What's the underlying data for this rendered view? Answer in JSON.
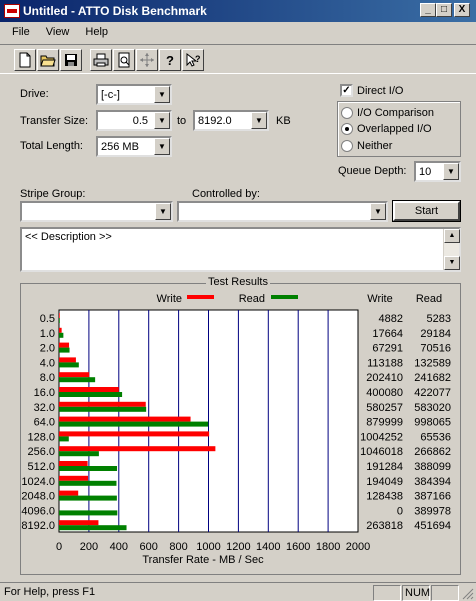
{
  "window": {
    "title": "Untitled - ATTO Disk Benchmark",
    "minimize": "_",
    "maximize": "□",
    "close": "X"
  },
  "menu": [
    "File",
    "View",
    "Help"
  ],
  "form": {
    "drive_label": "Drive:",
    "drive_value": "[-c-]",
    "transfer_size_label": "Transfer Size:",
    "transfer_from": "0.5",
    "to_label": "to",
    "transfer_to": "8192.0",
    "unit": "KB",
    "total_length_label": "Total Length:",
    "total_length_value": "256 MB",
    "direct_io_label": "Direct I/O",
    "io_comparison_label": "I/O Comparison",
    "overlapped_io_label": "Overlapped I/O",
    "neither_label": "Neither",
    "queue_depth_label": "Queue Depth:",
    "queue_depth_value": "10",
    "stripe_group_label": "Stripe Group:",
    "controlled_by_label": "Controlled by:",
    "start_label": "Start",
    "description": "<< Description >>"
  },
  "results": {
    "title": "Test Results",
    "write_label": "Write",
    "read_label": "Read",
    "col_write": "Write",
    "col_read": "Read",
    "xlabel": "Transfer Rate - MB / Sec"
  },
  "chart_data": {
    "type": "bar",
    "orientation": "horizontal",
    "categories": [
      "0.5",
      "1.0",
      "2.0",
      "4.0",
      "8.0",
      "16.0",
      "32.0",
      "64.0",
      "128.0",
      "256.0",
      "512.0",
      "1024.0",
      "2048.0",
      "4096.0",
      "8192.0"
    ],
    "series": [
      {
        "name": "Write",
        "color": "#ff0000",
        "values": [
          4.882,
          17.664,
          67.291,
          113.188,
          202.41,
          400.08,
          580.257,
          879.999,
          1004.252,
          1046.018,
          191.284,
          194.049,
          128.438,
          0,
          263.818
        ]
      },
      {
        "name": "Read",
        "color": "#008000",
        "values": [
          5.283,
          29.184,
          70.516,
          132.589,
          241.682,
          422.077,
          583.02,
          998.065,
          65.536,
          266.862,
          388.099,
          384.394,
          387.166,
          389.978,
          451.694
        ]
      }
    ],
    "write_text": [
      "4882",
      "17664",
      "67291",
      "113188",
      "202410",
      "400080",
      "580257",
      "879999",
      "1004252",
      "1046018",
      "191284",
      "194049",
      "128438",
      "0",
      "263818"
    ],
    "read_text": [
      "5283",
      "29184",
      "70516",
      "132589",
      "241682",
      "422077",
      "583020",
      "998065",
      "65536",
      "266862",
      "388099",
      "384394",
      "387166",
      "389978",
      "451694"
    ],
    "xticks": [
      "0",
      "200",
      "400",
      "600",
      "800",
      "1000",
      "1200",
      "1400",
      "1600",
      "1800",
      "2000"
    ],
    "xlim": [
      0,
      2000
    ],
    "xlabel": "Transfer Rate - MB / Sec"
  },
  "status": {
    "help": "For Help, press F1",
    "num": "NUM"
  }
}
